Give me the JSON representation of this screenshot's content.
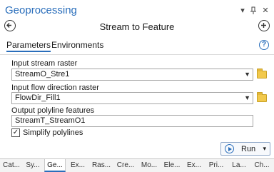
{
  "window": {
    "title": "Geoprocessing"
  },
  "tool": {
    "title": "Stream to Feature"
  },
  "tabs": [
    {
      "label": "Parameters",
      "active": true
    },
    {
      "label": "Environments",
      "active": false
    }
  ],
  "params": [
    {
      "label": "Input stream raster",
      "value": "StreamO_Stre1",
      "has_dropdown": true
    },
    {
      "label": "Input flow direction raster",
      "value": "FlowDir_Fill1",
      "has_dropdown": true
    },
    {
      "label": "Output polyline features",
      "value": "StreamT_StreamO1",
      "has_dropdown": false
    }
  ],
  "simplify": {
    "label": "Simplify polylines",
    "checked": true,
    "mark": "✓"
  },
  "run": {
    "label": "Run"
  },
  "bottom_tabs": [
    "Cat...",
    "Sy...",
    "Ge...",
    "Ex...",
    "Ras...",
    "Cre...",
    "Mo...",
    "Ele...",
    "Ex...",
    "Pri...",
    "La...",
    "Ch..."
  ],
  "icons": {
    "back": "back-arrow-icon",
    "add": "add-icon",
    "help": "help-icon",
    "folder": "folder-icon"
  },
  "colors": {
    "accent": "#2a6ebb"
  }
}
